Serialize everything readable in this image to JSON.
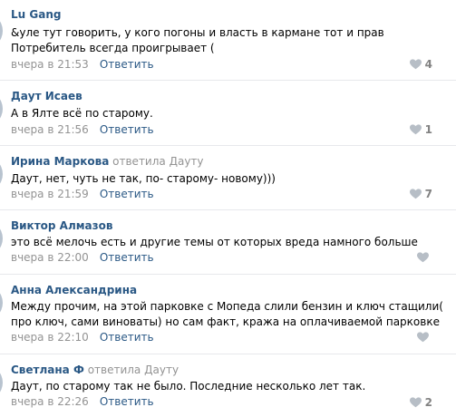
{
  "comments": [
    {
      "author": "Lu Gang",
      "reply_text": "",
      "reply_to": "",
      "text_lines": [
        "&уле тут говорить, у кого погоны и власть в кармане тот и прав",
        "Потребитель всегда проигрывает ("
      ],
      "date": "вчера в 21:53",
      "reply_label": "Ответить",
      "likes": "4"
    },
    {
      "author": "Даут Исаев",
      "reply_text": "",
      "reply_to": "",
      "text_lines": [
        "А в Ялте всё по старому."
      ],
      "date": "вчера в 21:56",
      "reply_label": "Ответить",
      "likes": "1"
    },
    {
      "author": "Ирина Маркова",
      "reply_text": "ответила",
      "reply_to": "Дауту",
      "text_lines": [
        "Даут, нет, чуть не так, по- старому- новому)))"
      ],
      "date": "вчера в 21:59",
      "reply_label": "Ответить",
      "likes": "7"
    },
    {
      "author": "Виктор Алмазов",
      "reply_text": "",
      "reply_to": "",
      "text_lines": [
        "это всё мелочь есть и другие темы от которых вреда намного больше"
      ],
      "date": "вчера в 22:00",
      "reply_label": "Ответить",
      "likes": ""
    },
    {
      "author": "Анна Александрина",
      "reply_text": "",
      "reply_to": "",
      "text_lines": [
        "Между прочим, на этой парковке с Мопеда слили бензин и ключ стащили(",
        "про ключ, сами виноваты) но сам факт, кража на оплачиваемой парковке"
      ],
      "date": "вчера в 22:10",
      "reply_label": "Ответить",
      "likes": ""
    },
    {
      "author": "Светлана Ф",
      "reply_text": "ответила",
      "reply_to": "Дауту",
      "text_lines": [
        "Даут, по старому так не было. Последние несколько лет так."
      ],
      "date": "вчера в 22:26",
      "reply_label": "Ответить",
      "likes": "2"
    }
  ],
  "colors": {
    "link": "#2a5885",
    "muted": "#939393",
    "divider": "#e7e8ec",
    "heart": "#b7bec6",
    "like_count": "#828282"
  }
}
